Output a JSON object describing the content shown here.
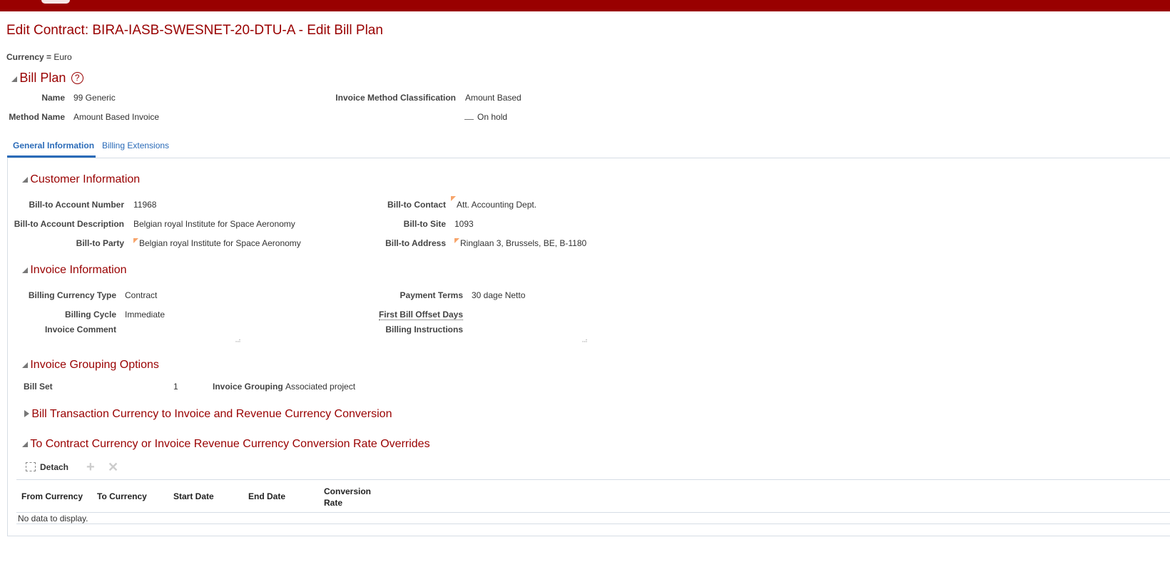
{
  "page": {
    "title": "Edit Contract: BIRA-IASB-SWESNET-20-DTU-A - Edit Bill Plan",
    "currency_label": "Currency =",
    "currency_value": "Euro"
  },
  "bill_plan": {
    "heading": "Bill Plan",
    "name_label": "Name",
    "name_value": "99 Generic",
    "method_label": "Method Name",
    "method_value": "Amount Based Invoice",
    "classification_label": "Invoice Method Classification",
    "classification_value": "Amount Based",
    "on_hold_label": "On hold"
  },
  "tabs": [
    {
      "label": "General Information",
      "active": true
    },
    {
      "label": "Billing Extensions",
      "active": false
    }
  ],
  "customer": {
    "heading": "Customer Information",
    "account_number_label": "Bill-to Account Number",
    "account_number": "11968",
    "account_description_label": "Bill-to Account Description",
    "account_description": "Belgian royal Institute for Space Aeronomy",
    "party_label": "Bill-to Party",
    "party": "Belgian royal Institute for Space Aeronomy",
    "contact_label": "Bill-to Contact",
    "contact": "Att. Accounting Dept.",
    "site_label": "Bill-to Site",
    "site": "1093",
    "address_label": "Bill-to Address",
    "address": "Ringlaan 3, Brussels, BE, B-1180"
  },
  "invoice": {
    "heading": "Invoice Information",
    "currency_type_label": "Billing Currency Type",
    "currency_type": "Contract",
    "cycle_label": "Billing Cycle",
    "cycle": "Immediate",
    "comment_label": "Invoice Comment",
    "payment_terms_label": "Payment Terms",
    "payment_terms": "30 dage Netto",
    "offset_days_label": "First Bill Offset Days",
    "instructions_label": "Billing Instructions"
  },
  "grouping": {
    "heading": "Invoice Grouping Options",
    "bill_set_label": "Bill Set",
    "bill_set": "1",
    "grouping_label": "Invoice Grouping",
    "grouping": "Associated project"
  },
  "conversion": {
    "heading": "Bill Transaction Currency to Invoice and Revenue Currency Conversion"
  },
  "overrides": {
    "heading": "To Contract Currency or Invoice Revenue Currency Conversion Rate Overrides",
    "detach_label": "Detach",
    "columns": [
      "From Currency",
      "To Currency",
      "Start Date",
      "End Date",
      "Conversion",
      "Rate"
    ],
    "empty": "No data to display."
  }
}
